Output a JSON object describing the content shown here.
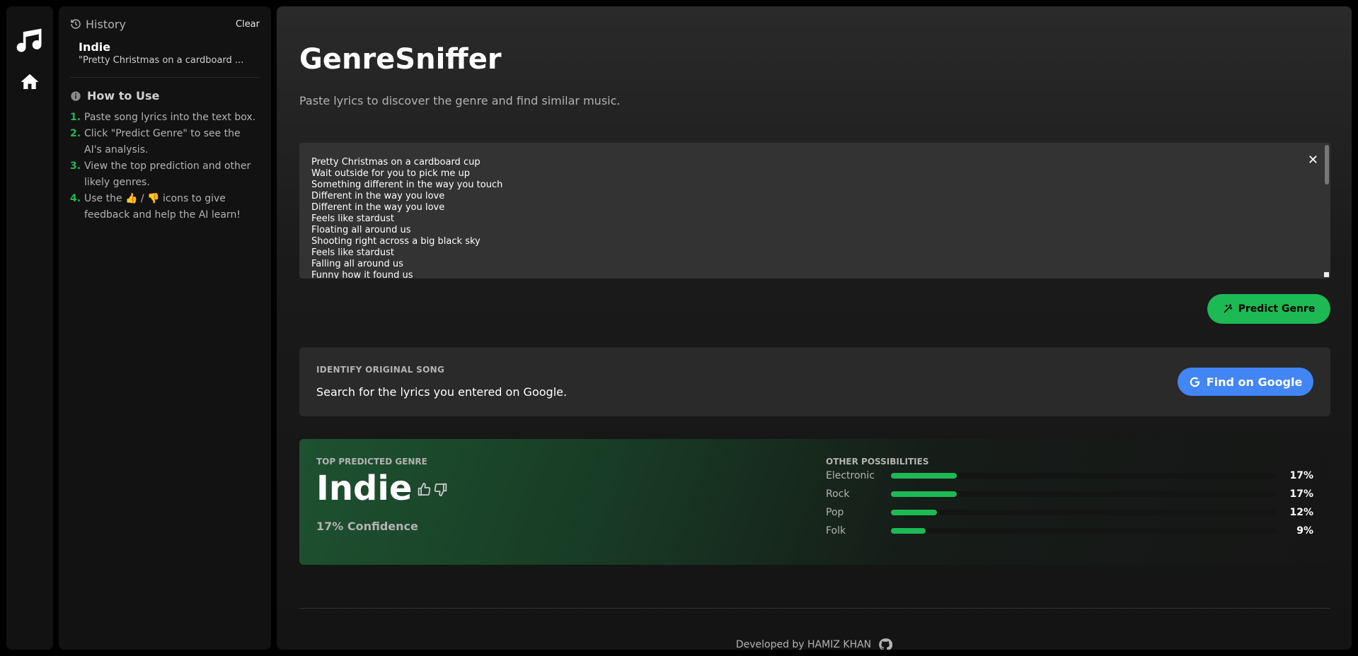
{
  "app": {
    "title": "GenreSniffer",
    "subtitle": "Paste lyrics to discover the genre and find similar music."
  },
  "nav": {
    "logo_icon": "music-note-icon",
    "home_icon": "home-icon"
  },
  "history": {
    "title": "History",
    "clear_label": "Clear",
    "items": [
      {
        "genre": "Indie",
        "snippet": "\"Pretty Christmas on a cardboard ..."
      }
    ]
  },
  "howto": {
    "title": "How to Use",
    "steps": [
      {
        "num": "1.",
        "text": "Paste song lyrics into the text box."
      },
      {
        "num": "2.",
        "text": "Click \"Predict Genre\" to see the AI's analysis."
      },
      {
        "num": "3.",
        "text": "View the top prediction and other likely genres."
      },
      {
        "num": "4.",
        "text": "Use the 👍 / 👎 icons to give feedback and help the AI learn!"
      }
    ]
  },
  "lyrics": {
    "lines": [
      "Pretty Christmas on a cardboard cup",
      "Wait outside for you to pick me up",
      "Something different in the way you touch",
      "Different in the way you love",
      "Different in the way you love",
      "Feels like stardust",
      "Floating all around us",
      "Shooting right across a big black sky",
      "Feels like stardust",
      "Falling all around us",
      "Funny how it found us"
    ],
    "clear_symbol": "✕"
  },
  "predict_button": {
    "label": "Predict Genre",
    "icon": "magic-wand-icon"
  },
  "identify": {
    "label": "IDENTIFY ORIGINAL SONG",
    "text": "Search for the lyrics you entered on Google.",
    "button_label": "Find on Google",
    "button_icon": "google-g-icon"
  },
  "result": {
    "label": "TOP PREDICTED GENRE",
    "genre": "Indie",
    "confidence": "17% Confidence",
    "others_label": "OTHER POSSIBILITIES",
    "others": [
      {
        "name": "Electronic",
        "pct": "17%",
        "value": 0.17
      },
      {
        "name": "Rock",
        "pct": "17%",
        "value": 0.17
      },
      {
        "name": "Pop",
        "pct": "12%",
        "value": 0.12
      },
      {
        "name": "Folk",
        "pct": "9%",
        "value": 0.09
      }
    ]
  },
  "footer": {
    "text": "Developed by HAMIZ KHAN",
    "icon": "github-icon"
  },
  "colors": {
    "accent": "#1db954",
    "google_blue": "#4285f4",
    "background": "#000000",
    "panel": "#121212"
  }
}
